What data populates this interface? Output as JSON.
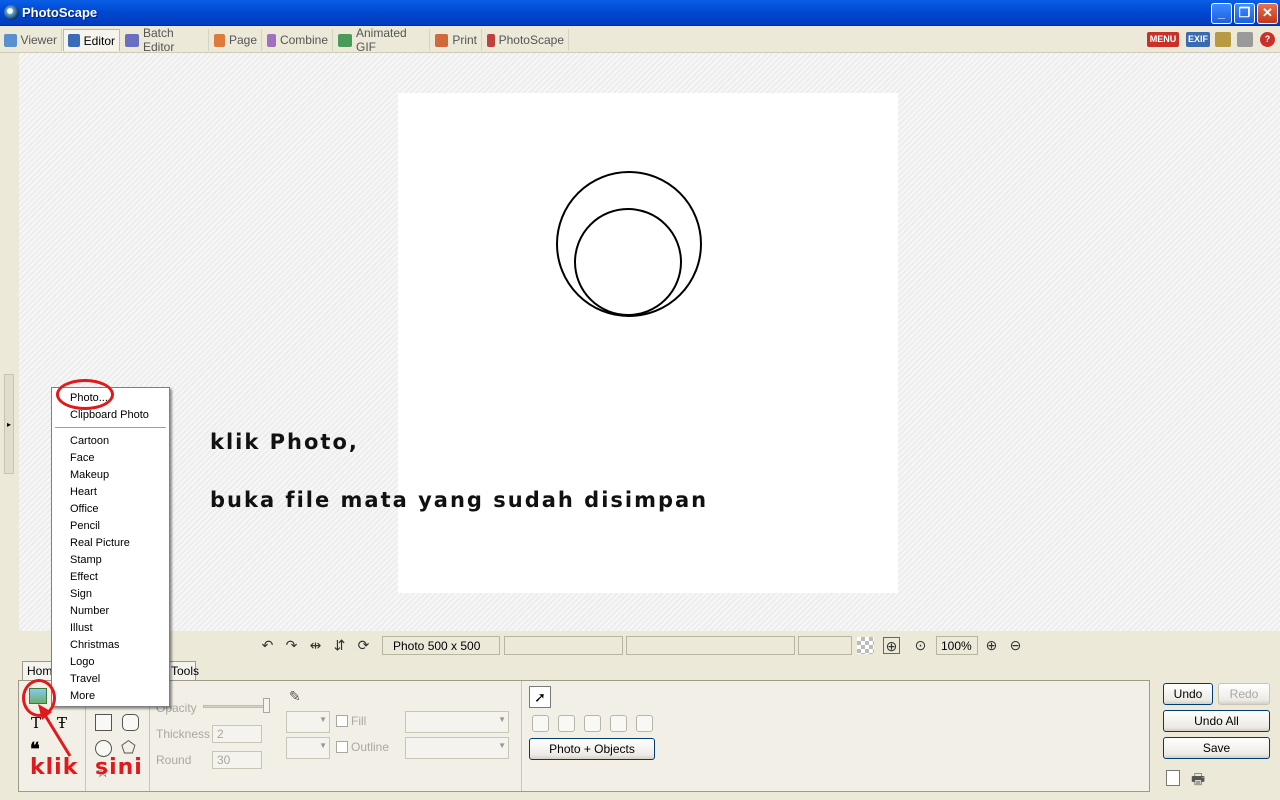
{
  "window": {
    "title": "PhotoScape",
    "minimize": "_",
    "restore": "❐",
    "close": "✕"
  },
  "tabs": [
    {
      "label": "Viewer",
      "color": "#5a8fd0"
    },
    {
      "label": "Editor",
      "color": "#3a6cb8"
    },
    {
      "label": "Batch Editor",
      "color": "#6a70c0"
    },
    {
      "label": "Page",
      "color": "#e07a3a"
    },
    {
      "label": "Combine",
      "color": "#a070c0"
    },
    {
      "label": "Animated GIF",
      "color": "#4a9a5a"
    },
    {
      "label": "Print",
      "color": "#d06a3a"
    },
    {
      "label": "PhotoScape",
      "color": "#c04040"
    }
  ],
  "right_icons": {
    "menu": "MENU",
    "exif": "EXIF",
    "help": "?"
  },
  "annotations": {
    "line1": "klik Photo,",
    "line2": "buka file mata yang sudah disimpan",
    "red_klik": "klik",
    "red_sini": "sini"
  },
  "status": {
    "photo_size": "Photo 500 x 500",
    "zoom": "100%"
  },
  "bottom_tabs": {
    "home": "Home",
    "tools": "Tools"
  },
  "toolbox": {
    "opacity_label": "Opacity",
    "thickness_label": "Thickness",
    "thickness_value": "2",
    "round_label": "Round",
    "round_value": "30",
    "fill_label": "Fill",
    "outline_label": "Outline",
    "photo_objects_label": "Photo + Objects"
  },
  "actions": {
    "undo": "Undo",
    "redo": "Redo",
    "undo_all": "Undo All",
    "save": "Save"
  },
  "insert_menu": {
    "items": [
      "Photo...",
      "Clipboard Photo"
    ],
    "items2": [
      "Cartoon",
      "Face",
      "Makeup",
      "Heart",
      "Office",
      "Pencil",
      "Real Picture",
      "Stamp",
      "Effect",
      "Sign",
      "Number",
      "Illust",
      "Christmas",
      "Logo",
      "Travel",
      "More"
    ]
  }
}
